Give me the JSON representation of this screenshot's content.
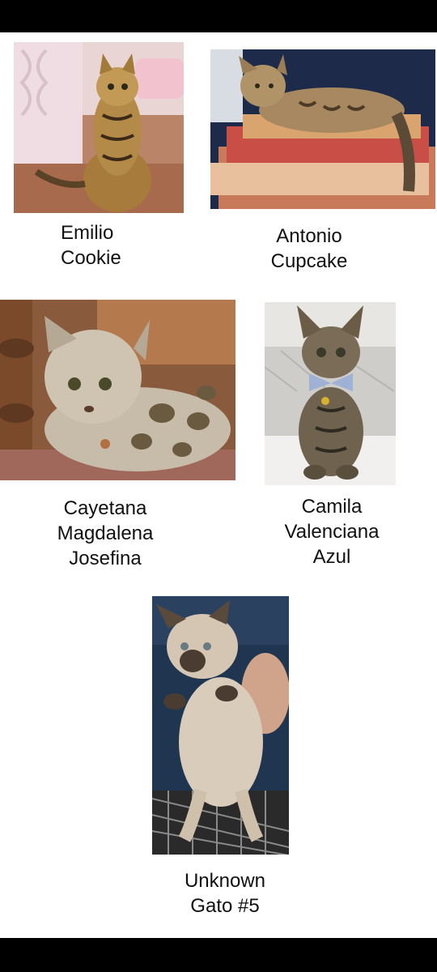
{
  "cats": [
    {
      "lines": [
        "Emilio",
        "Cookie"
      ],
      "photo": "tabby-kitten-sitting-photo"
    },
    {
      "lines": [
        "Antonio",
        "Cupcake"
      ],
      "photo": "cat-on-blankets-photo"
    },
    {
      "lines": [
        "Cayetana",
        "Magdalena",
        "Josefina"
      ],
      "photo": "spotted-kitten-lying-photo"
    },
    {
      "lines": [
        "Camila",
        "Valenciana",
        "Azul"
      ],
      "photo": "kitten-with-bow-photo"
    },
    {
      "lines": [
        "Unknown",
        "Gato #5"
      ],
      "photo": "fluffy-cat-held-photo"
    }
  ],
  "colors": {
    "background": "#ffffff",
    "text": "#111111",
    "bars": "#000000"
  }
}
